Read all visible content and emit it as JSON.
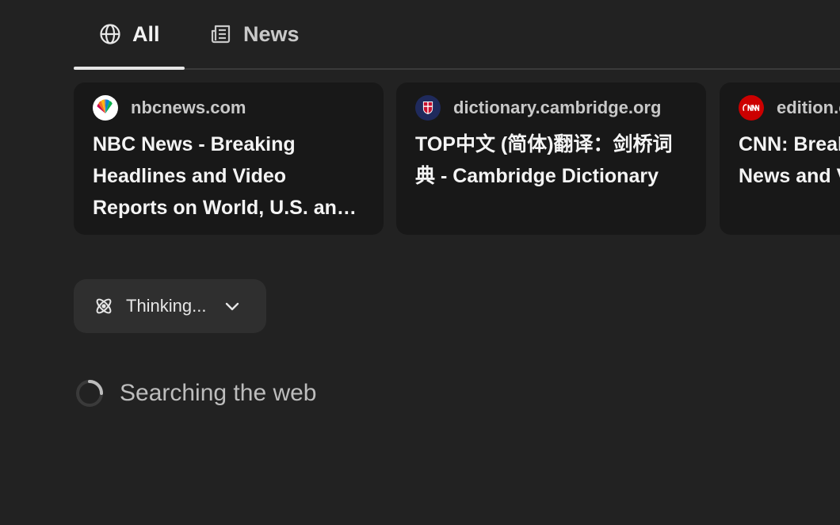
{
  "tabs": [
    {
      "label": "All",
      "icon": "globe-icon",
      "active": true
    },
    {
      "label": "News",
      "icon": "newspaper-icon",
      "active": false
    }
  ],
  "cards": [
    {
      "source": "nbcnews.com",
      "title": "NBC News - Breaking Headlines and Video Reports on World, U.S. and Local News",
      "favicon": "nbc-peacock-icon"
    },
    {
      "source": "dictionary.cambridge.org",
      "title": "TOP中文 (简体)翻译：剑桥词典 - Cambridge Dictionary",
      "favicon": "cambridge-crest-icon"
    },
    {
      "source": "edition.cnn.com",
      "title": "CNN: Breaking News, Latest News and Videos",
      "favicon": "cnn-logo-icon"
    }
  ],
  "thinking": {
    "label": "Thinking...",
    "icon": "atom-icon"
  },
  "status": {
    "text": "Searching the web"
  },
  "colors": {
    "background": "#222222",
    "card": "#181818",
    "pill": "#2f2f2f",
    "cnn_red": "#cc0000",
    "cambridge_navy": "#1f2a5c"
  }
}
